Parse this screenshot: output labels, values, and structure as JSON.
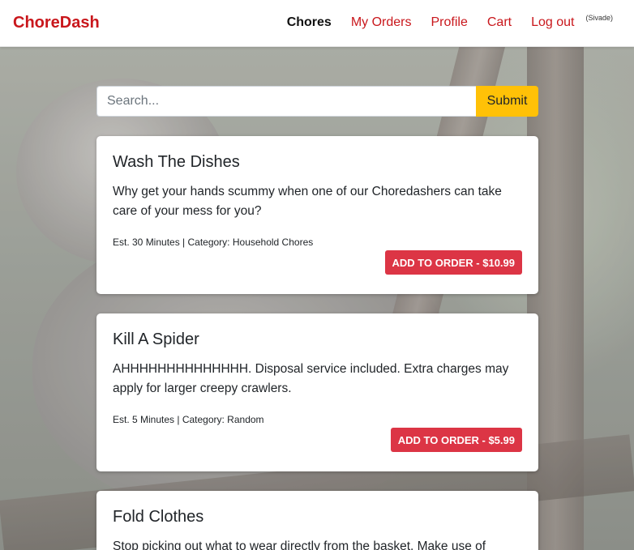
{
  "brand": "ChoreDash",
  "nav": {
    "items": [
      {
        "label": "Chores"
      },
      {
        "label": "My Orders"
      },
      {
        "label": "Profile"
      },
      {
        "label": "Cart"
      },
      {
        "label": "Log out"
      }
    ],
    "user": "(Sivade)"
  },
  "search": {
    "placeholder": "Search...",
    "value": "",
    "submit_label": "Submit"
  },
  "chores": [
    {
      "title": "Wash The Dishes",
      "description": "Why get your hands scummy when one of our Choredashers can take care of your mess for you?",
      "meta": "Est. 30 Minutes | Category: Household Chores",
      "button": "ADD TO ORDER - $10.99"
    },
    {
      "title": "Kill A Spider",
      "description": "AHHHHHHHHHHHHHH. Disposal service included. Extra charges may apply for larger creepy crawlers.",
      "meta": "Est. 5 Minutes | Category: Random",
      "button": "ADD TO ORDER - $5.99"
    },
    {
      "title": "Fold Clothes",
      "description": "Stop picking out what to wear directly from the basket. Make use of",
      "meta": "",
      "button": ""
    }
  ],
  "colors": {
    "brand": "#c9171c",
    "submit": "#ffc107",
    "add_button": "#dc3545"
  }
}
